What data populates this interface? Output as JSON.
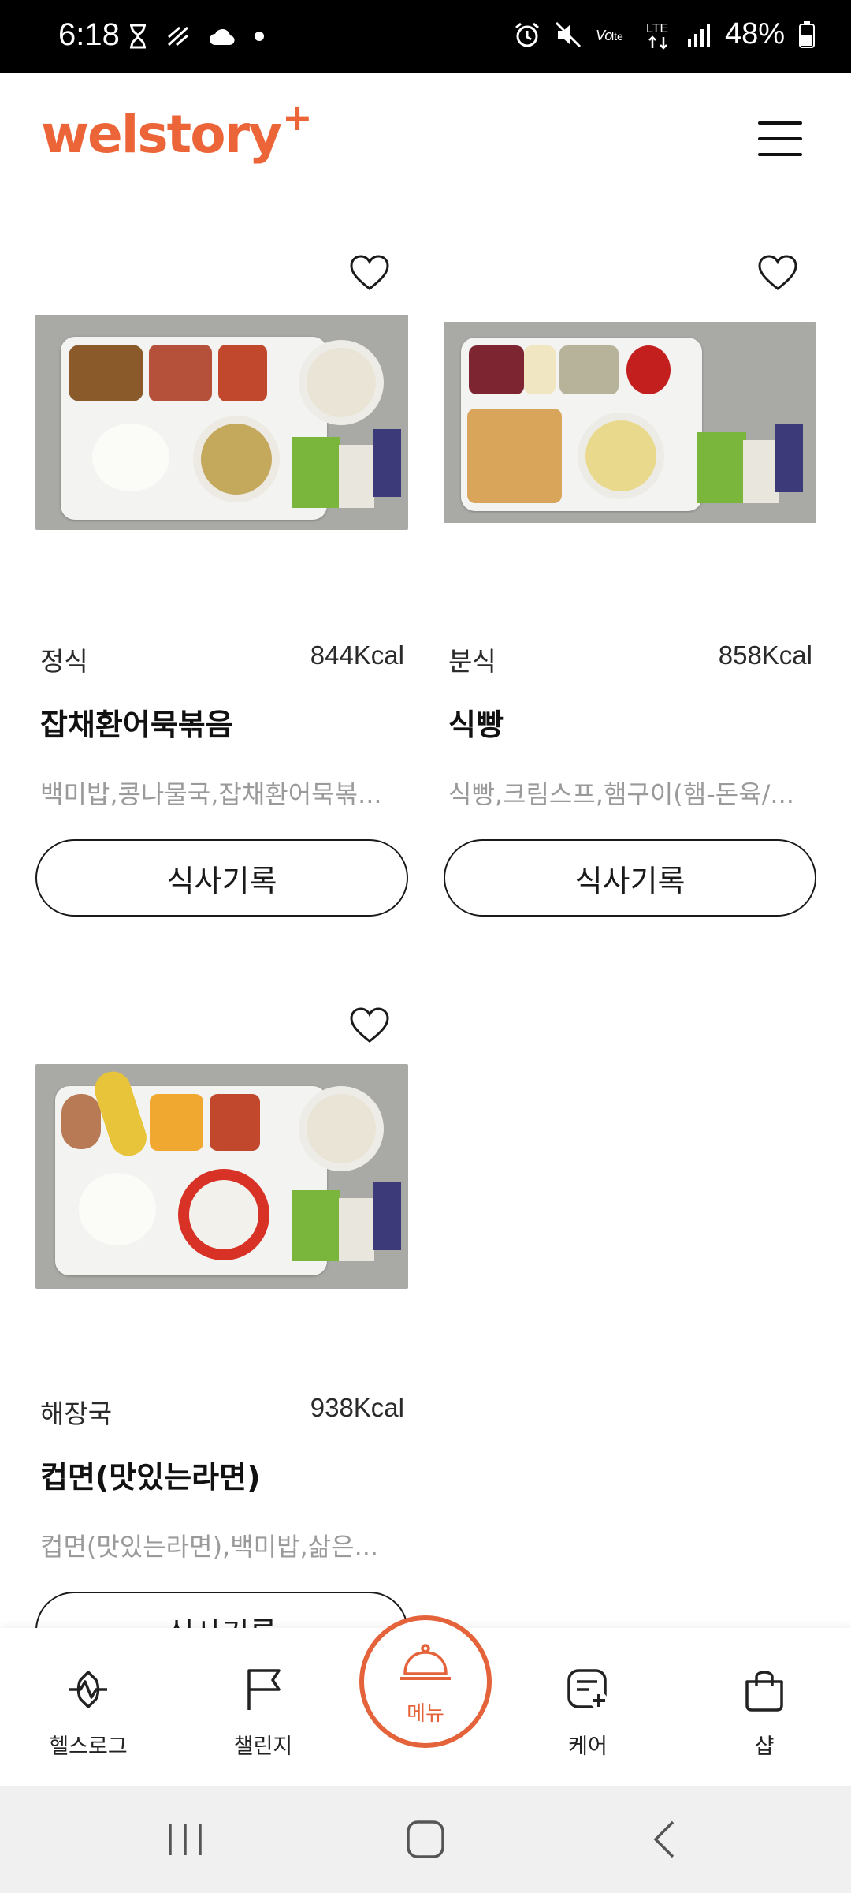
{
  "status_bar": {
    "time": "6:18",
    "battery": "48%",
    "network": "LTE",
    "icons": [
      "hourglass-icon",
      "data-saver-icon",
      "cloud-icon",
      "dot-icon",
      "alarm-icon",
      "mute-icon",
      "volte-icon",
      "lte-icon",
      "signal-icon",
      "battery-icon"
    ]
  },
  "header": {
    "logo_text": "welstory",
    "logo_plus": "+",
    "brand_color": "#ec6538"
  },
  "menu_cards": [
    {
      "category": "정식",
      "kcal": "844Kcal",
      "title": "잡채환어묵볶음",
      "description": "백미밥,콩나물국,잡채환어묵볶...",
      "button": "식사기록"
    },
    {
      "category": "분식",
      "kcal": "858Kcal",
      "title": "식빵",
      "description": "식빵,크림스프,햄구이(햄-돈육/...",
      "button": "식사기록"
    },
    {
      "category": "해장국",
      "kcal": "938Kcal",
      "title": "컵면(맛있는라면)",
      "description": "컵면(맛있는라면),백미밥,삶은...",
      "button": "식사기록"
    }
  ],
  "bottom_nav": {
    "items": [
      {
        "label": "헬스로그",
        "icon": "health-log-icon"
      },
      {
        "label": "챌린지",
        "icon": "flag-icon"
      },
      {
        "label": "메뉴",
        "icon": "cloche-icon"
      },
      {
        "label": "케어",
        "icon": "care-note-icon"
      },
      {
        "label": "샵",
        "icon": "shopping-bag-icon"
      }
    ],
    "accent": "#e5633a"
  }
}
